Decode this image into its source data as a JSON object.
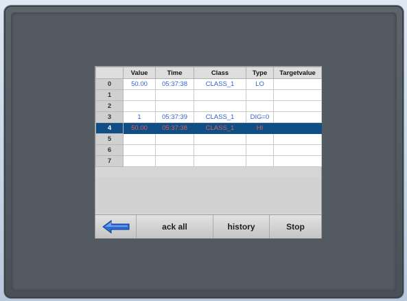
{
  "table": {
    "headers": [
      "Value",
      "Time",
      "Class",
      "Type",
      "Targetvalue"
    ],
    "rows": [
      {
        "index": "0",
        "value": "50.00",
        "time": "05:37:38",
        "class": "CLASS_1",
        "type": "LO",
        "target": "",
        "style": "blue"
      },
      {
        "index": "1",
        "value": "",
        "time": "",
        "class": "",
        "type": "",
        "target": "",
        "style": "orange"
      },
      {
        "index": "2",
        "value": "",
        "time": "",
        "class": "",
        "type": "",
        "target": "",
        "style": "orange"
      },
      {
        "index": "3",
        "value": "1",
        "time": "05:37:39",
        "class": "CLASS_1",
        "type": "DIG=0",
        "target": "",
        "style": "blue"
      },
      {
        "index": "4",
        "value": "50.00",
        "time": "05:37:38",
        "class": "CLASS_1",
        "type": "HI",
        "target": "",
        "style": "sel"
      },
      {
        "index": "5",
        "value": "",
        "time": "",
        "class": "",
        "type": "",
        "target": "",
        "style": "orange"
      },
      {
        "index": "6",
        "value": "",
        "time": "",
        "class": "",
        "type": "",
        "target": "",
        "style": "orange"
      },
      {
        "index": "7",
        "value": "",
        "time": "",
        "class": "",
        "type": "",
        "target": "",
        "style": "orange"
      }
    ]
  },
  "buttons": {
    "back_icon": "back-arrow-icon",
    "ack_all": "ack all",
    "history": "history",
    "stop": "Stop"
  },
  "colors": {
    "selected_row": "#0f4f86",
    "blue_text": "#2a5fd0",
    "orange_text": "#f0a070",
    "bezel": "#545a61"
  }
}
